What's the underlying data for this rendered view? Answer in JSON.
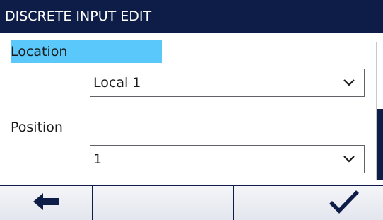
{
  "header": {
    "title": "DISCRETE INPUT EDIT"
  },
  "fields": [
    {
      "label": "Location",
      "value": "Local 1",
      "selected": true
    },
    {
      "label": "Position",
      "value": "1",
      "selected": false
    }
  ],
  "softkeys": [
    {
      "icon": "arrow-left-icon"
    },
    {
      "icon": ""
    },
    {
      "icon": ""
    },
    {
      "icon": ""
    },
    {
      "icon": "checkmark-icon"
    }
  ],
  "colors": {
    "header_bg": "#0e1d47",
    "selection": "#5ac8fa",
    "text": "#1a1a1a"
  }
}
